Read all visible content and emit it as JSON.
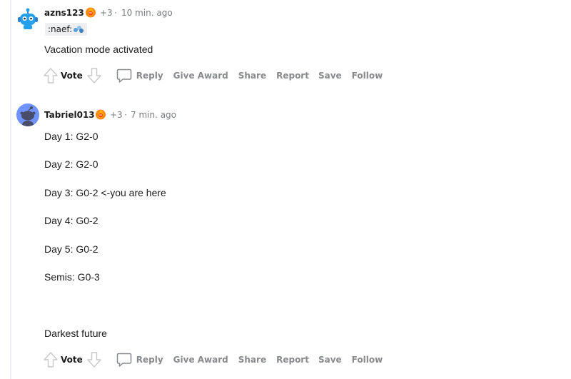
{
  "colors": {
    "meta_gray": "#787c7e",
    "action_gray": "#878a8c",
    "thread_line": "#edeff1",
    "avatar1_bg": "#ffffff",
    "avatar2_bg": "#7193ff"
  },
  "comments": [
    {
      "username": "azns123",
      "award_icon": "award-flame-icon",
      "karma": "+3",
      "separator": "·",
      "time": "10 min. ago",
      "flair": ":naef:",
      "flair_icon": "bubbles-icon",
      "body": [
        "Vacation mode activated"
      ],
      "actions": {
        "vote": "Vote",
        "reply": "Reply",
        "give_award": "Give Award",
        "share": "Share",
        "report": "Report",
        "save": "Save",
        "follow": "Follow"
      }
    },
    {
      "username": "Tabriel013",
      "award_icon": "award-flame-icon",
      "karma": "+3",
      "separator": "·",
      "time": "7 min. ago",
      "body": [
        "Day 1: G2-0",
        "Day 2: G2-0",
        "Day 3: G0-2 <-you are here",
        "Day 4: G0-2",
        "Day 5: G0-2",
        "Semis: G0-3",
        "Darkest future"
      ],
      "actions": {
        "vote": "Vote",
        "reply": "Reply",
        "give_award": "Give Award",
        "share": "Share",
        "report": "Report",
        "save": "Save",
        "follow": "Follow"
      }
    }
  ]
}
